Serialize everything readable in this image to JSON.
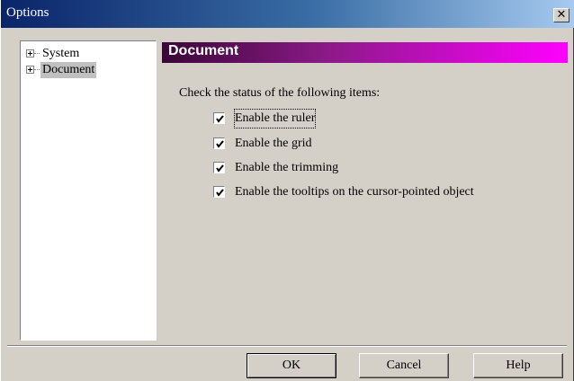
{
  "window": {
    "title": "Options",
    "close_glyph": "✕"
  },
  "tree": {
    "items": [
      {
        "label": "System",
        "icon": "expand-plus-icon"
      },
      {
        "label": "Document",
        "icon": "expand-plus-icon",
        "selected": true
      }
    ]
  },
  "panel": {
    "header": "Document",
    "intro": "Check the status of the following items:",
    "options": [
      {
        "label": "Enable the ruler",
        "checked": true
      },
      {
        "label": "Enable the grid",
        "checked": true
      },
      {
        "label": "Enable the trimming",
        "checked": true
      },
      {
        "label": "Enable the tooltips on the cursor-pointed object",
        "checked": true
      }
    ]
  },
  "buttons": {
    "ok": "OK",
    "cancel": "Cancel",
    "help": "Help"
  },
  "colors": {
    "title_gradient_start": "#0a246a",
    "header_gradient_start": "#3a0638",
    "header_gradient_end": "#ff00ff",
    "face": "#d4d0c8"
  }
}
